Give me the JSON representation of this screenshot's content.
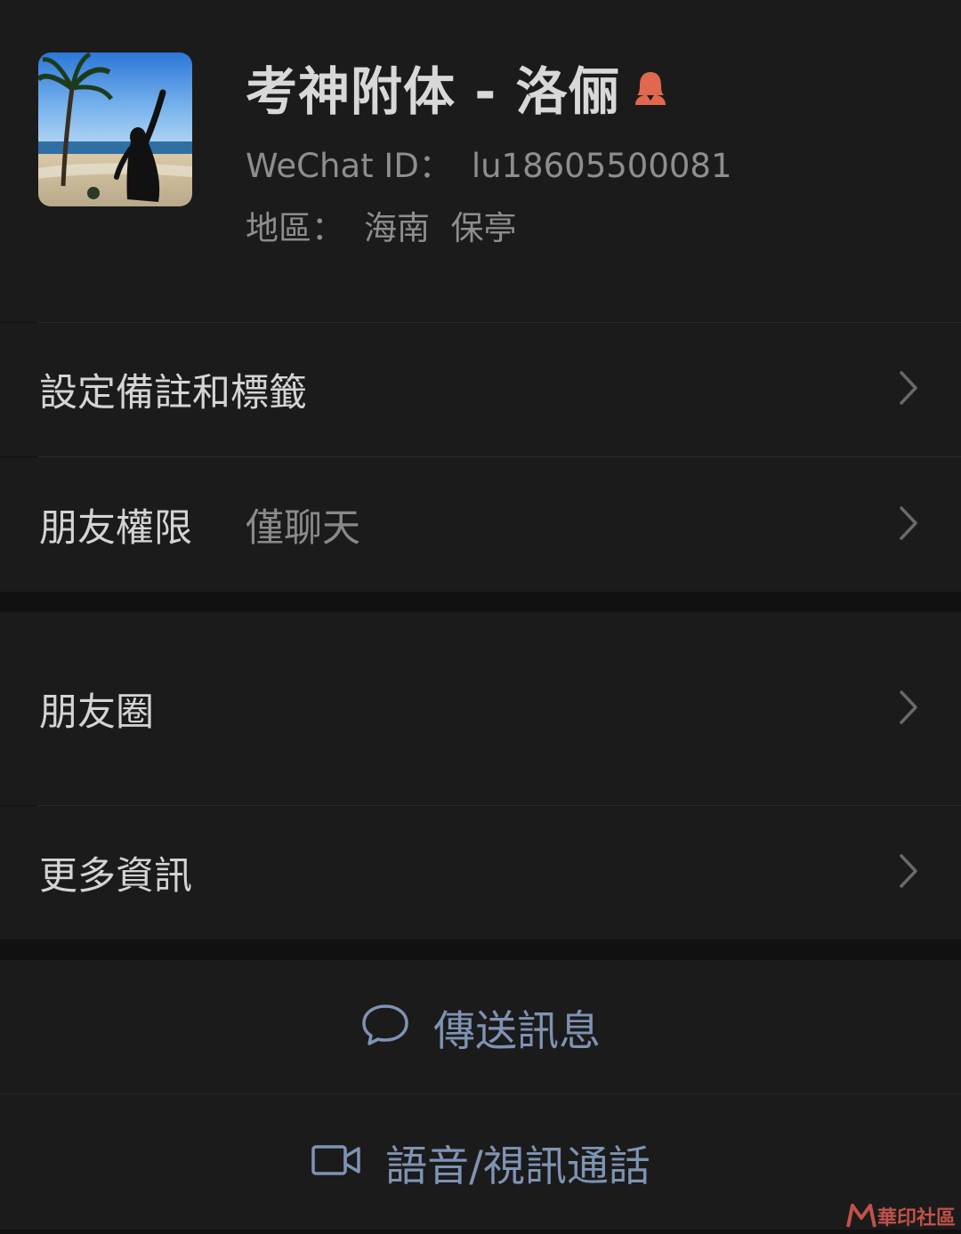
{
  "profile": {
    "name": "考神附体 - 洛俪",
    "wechat_id_label": "WeChat ID：",
    "wechat_id_value": "lu18605500081",
    "region_label": "地區：",
    "region_value": "海南  保亭",
    "gender_icon": "female-icon",
    "avatar_icon": "beach-photo"
  },
  "menu": {
    "remark_label": "設定備註和標籤",
    "permission_label": "朋友權限",
    "permission_value": "僅聊天",
    "moments_label": "朋友圈",
    "more_info_label": "更多資訊"
  },
  "actions": {
    "send_message": "傳送訊息",
    "voice_video_call": "語音/視訊通話"
  },
  "watermark": {
    "text": "華印社區"
  },
  "colors": {
    "background": "#111111",
    "panel": "#1b1b1b",
    "action_text": "#7f93b3",
    "gender_icon": "#e0684e"
  }
}
